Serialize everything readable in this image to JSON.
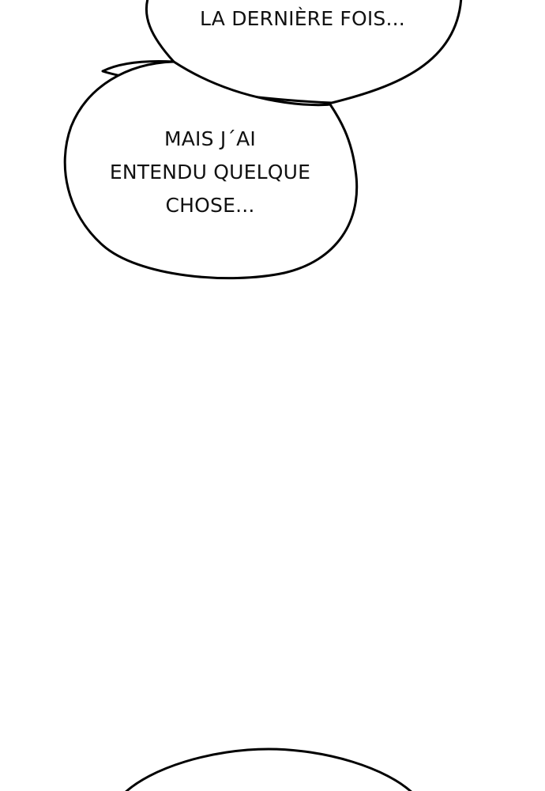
{
  "page": {
    "background": "#ffffff",
    "ink_color": "#000000"
  },
  "bubbles": [
    {
      "lines": [
        "LA DERNIÈRE FOIS..."
      ]
    },
    {
      "lines": [
        "MAIS J´AI",
        "ENTENDU QUELQUE",
        "CHOSE..."
      ]
    },
    {
      "lines": []
    }
  ]
}
